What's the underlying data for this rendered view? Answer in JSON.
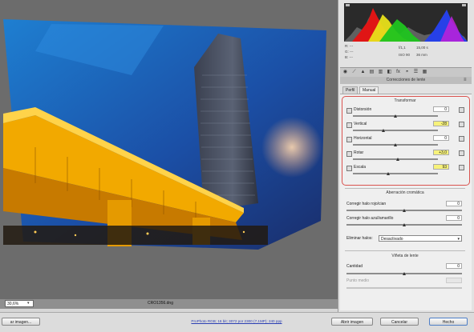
{
  "canvas": {
    "zoom": "30,6%",
    "filename": "CRO1356.dng"
  },
  "info": {
    "r": "R: ---",
    "g": "G: ---",
    "b": "B: ---",
    "aperture": "f/1,1",
    "time": "15,00 s",
    "iso": "ISO 90",
    "lens": "36 mm"
  },
  "panel": {
    "section_title": "Correcciones de lente",
    "tabs": [
      "Perfil",
      "Manual"
    ],
    "transform": {
      "title": "Transformar",
      "rows": [
        {
          "label": "Distorsión",
          "value": "0",
          "highlighted": false,
          "thumb": 0.5
        },
        {
          "label": "Vertical",
          "value": "-28",
          "highlighted": true,
          "thumb": 0.36
        },
        {
          "label": "Horizontal",
          "value": "0",
          "highlighted": false,
          "thumb": 0.5
        },
        {
          "label": "Rotar",
          "value": "+3,0",
          "highlighted": true,
          "thumb": 0.53
        },
        {
          "label": "Escala",
          "value": "93",
          "highlighted": true,
          "thumb": 0.42
        }
      ]
    },
    "chromatic": {
      "title": "Aberración cromática",
      "rows": [
        {
          "label": "Corregir halo rojo/cian",
          "value": "0",
          "thumb": 0.5
        },
        {
          "label": "Corregir halo azul/amarillo",
          "value": "0",
          "thumb": 0.5
        }
      ],
      "defringe_label": "Eliminar halos:",
      "defringe_value": "Desactivado"
    },
    "vignette": {
      "title": "Viñeta de lente",
      "amount_label": "Cantidad",
      "amount_value": "0",
      "amount_thumb": 0.5,
      "midpoint_label": "Punto medio"
    }
  },
  "footer": {
    "save_button": "ar imagen...",
    "link": "ProPhoto RGB; 16 bit; 3072 por 2300 (7,1MP); 240 ppp",
    "open_button": "Abrir imagen",
    "cancel_button": "Cancelar",
    "done_button": "Hecho"
  }
}
